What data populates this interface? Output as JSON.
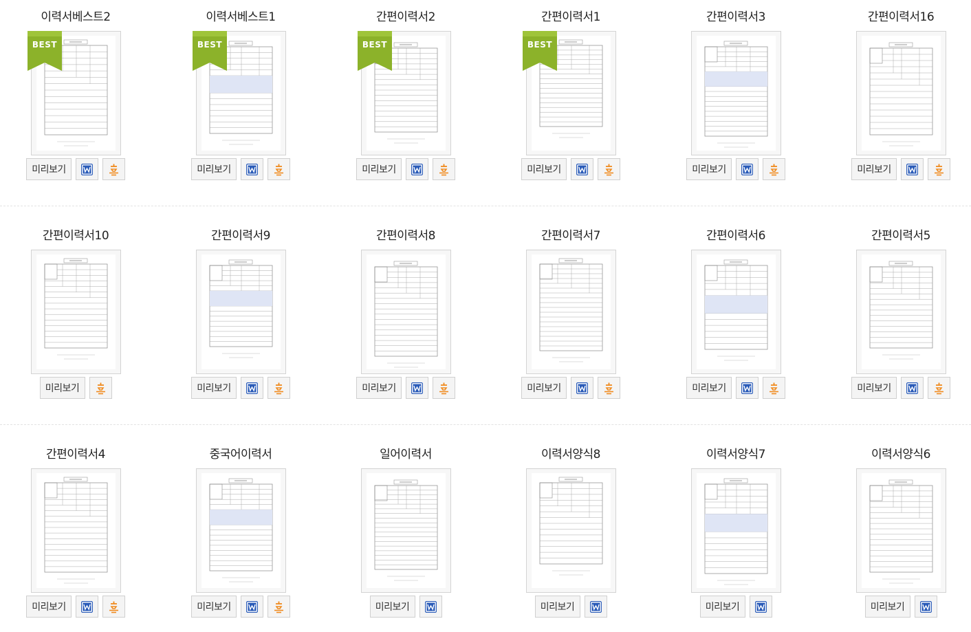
{
  "buttons": {
    "preview_label": "미리보기",
    "word_icon": "word-doc-icon",
    "hwp_icon": "hwp-doc-icon"
  },
  "badge": {
    "label": "BEST",
    "color": "#8cb22a"
  },
  "colors": {
    "word": "#2a5bb8",
    "hwp": "#f08a1c"
  },
  "templates": [
    {
      "title": "이력서베스트2",
      "best": true,
      "word": true,
      "hwp": true
    },
    {
      "title": "이력서베스트1",
      "best": true,
      "word": true,
      "hwp": true
    },
    {
      "title": "간편이력서2",
      "best": true,
      "word": true,
      "hwp": true
    },
    {
      "title": "간편이력서1",
      "best": true,
      "word": true,
      "hwp": true
    },
    {
      "title": "간편이력서3",
      "best": false,
      "word": true,
      "hwp": true
    },
    {
      "title": "간편이력서16",
      "best": false,
      "word": true,
      "hwp": true
    },
    {
      "title": "간편이력서10",
      "best": false,
      "word": false,
      "hwp": true
    },
    {
      "title": "간편이력서9",
      "best": false,
      "word": true,
      "hwp": true
    },
    {
      "title": "간편이력서8",
      "best": false,
      "word": true,
      "hwp": true
    },
    {
      "title": "간편이력서7",
      "best": false,
      "word": true,
      "hwp": true
    },
    {
      "title": "간편이력서6",
      "best": false,
      "word": true,
      "hwp": true
    },
    {
      "title": "간편이력서5",
      "best": false,
      "word": true,
      "hwp": true
    },
    {
      "title": "간편이력서4",
      "best": false,
      "word": true,
      "hwp": true
    },
    {
      "title": "중국어이력서",
      "best": false,
      "word": true,
      "hwp": true
    },
    {
      "title": "일어이력서",
      "best": false,
      "word": true,
      "hwp": false
    },
    {
      "title": "이력서양식8",
      "best": false,
      "word": true,
      "hwp": false
    },
    {
      "title": "이력서양식7",
      "best": false,
      "word": true,
      "hwp": false
    },
    {
      "title": "이력서양식6",
      "best": false,
      "word": true,
      "hwp": false
    }
  ]
}
